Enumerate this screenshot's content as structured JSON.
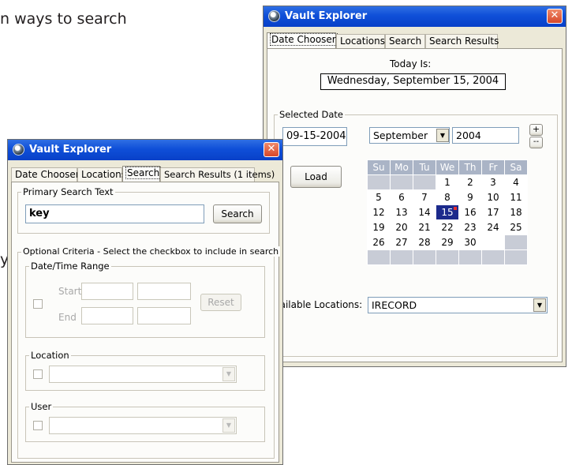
{
  "background": {
    "caption_line1": "n ways to search",
    "caption_line2": "y"
  },
  "window1": {
    "title": "Vault Explorer",
    "close_label": "✕",
    "tabs": [
      {
        "label": "Date Chooser",
        "active": true
      },
      {
        "label": "Locations",
        "active": false
      },
      {
        "label": "Search",
        "active": false
      },
      {
        "label": "Search Results",
        "active": false
      }
    ],
    "today_label": "Today Is:",
    "today_value": "Wednesday, September 15, 2004",
    "selected_date_legend": "Selected Date",
    "date_value": "09-15-2004",
    "month_value": "September",
    "year_value": "2004",
    "plus_label": "+",
    "minus_label": "--",
    "load_label": "Load",
    "weekdays": [
      "Su",
      "Mo",
      "Tu",
      "We",
      "Th",
      "Fr",
      "Sa"
    ],
    "weeks": [
      [
        "",
        "",
        "",
        "1",
        "2",
        "3",
        "4"
      ],
      [
        "5",
        "6",
        "7",
        "8",
        "9",
        "10",
        "11"
      ],
      [
        "12",
        "13",
        "14",
        "15",
        "16",
        "17",
        "18"
      ],
      [
        "19",
        "20",
        "21",
        "22",
        "23",
        "24",
        "25"
      ],
      [
        "26",
        "27",
        "28",
        "29",
        "30",
        "",
        ""
      ],
      [
        "",
        "",
        "",
        "",
        "",
        "",
        ""
      ]
    ],
    "selected_day": "15",
    "locations_label": "Available Locations:",
    "locations_value": "IRECORD",
    "colors": {
      "header": "#aab4c6",
      "selected": "#1c2a8c",
      "blank": "#c8ccd6"
    }
  },
  "window2": {
    "title": "Vault Explorer",
    "close_label": "✕",
    "tabs": [
      {
        "label": "Date Chooser",
        "active": false
      },
      {
        "label": "Locations",
        "active": false
      },
      {
        "label": "Search",
        "active": true
      },
      {
        "label": "Search Results (1 items)",
        "active": false
      }
    ],
    "primary_legend": "Primary Search Text",
    "search_value": "key",
    "search_button": "Search",
    "optional_legend": "Optional Criteria - Select the checkbox to include in search",
    "datetime_legend": "Date/Time Range",
    "start_label": "Start",
    "end_label": "End",
    "reset_label": "Reset",
    "location_legend": "Location",
    "user_legend": "User"
  }
}
